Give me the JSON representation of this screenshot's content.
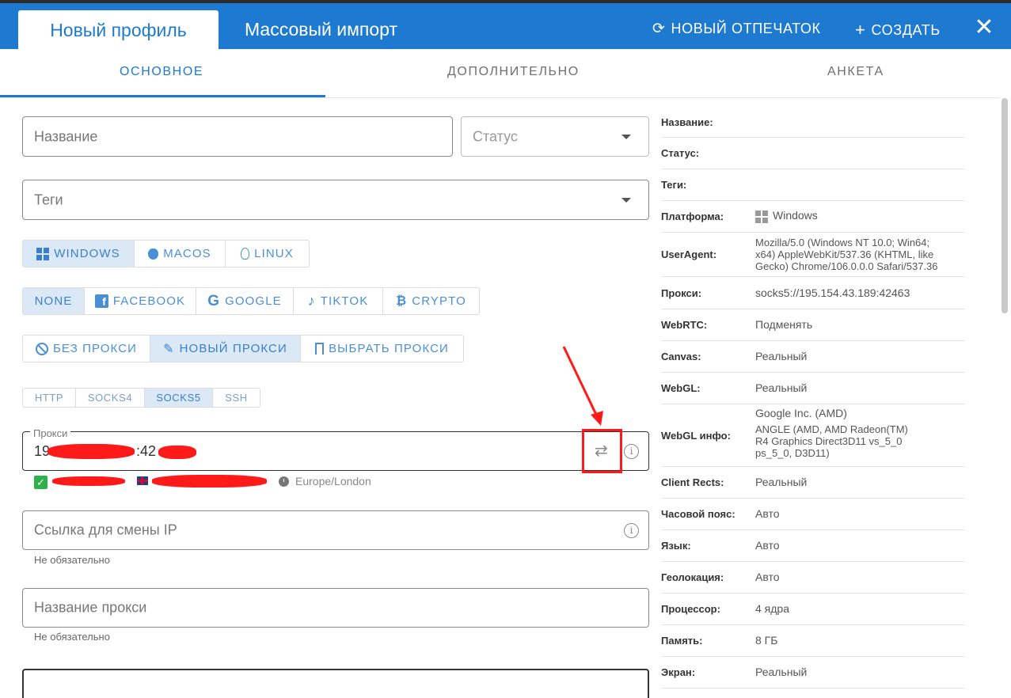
{
  "header": {
    "tab_new_profile": "Новый профиль",
    "tab_mass_import": "Массовый импорт",
    "new_fingerprint": "НОВЫЙ ОТПЕЧАТОК",
    "create": "СОЗДАТЬ",
    "close": "✕"
  },
  "subtabs": [
    "ОСНОВНОЕ",
    "ДОПОЛНИТЕЛЬНО",
    "АНКЕТА"
  ],
  "form": {
    "name_placeholder": "Название",
    "status_placeholder": "Статус",
    "tags_placeholder": "Теги",
    "os_options": [
      "WINDOWS",
      "MACOS",
      "LINUX"
    ],
    "preset_options": [
      "NONE",
      "FACEBOOK",
      "GOOGLE",
      "TIKTOK",
      "CRYPTO"
    ],
    "proxy_mode_options": [
      "БЕЗ ПРОКСИ",
      "НОВЫЙ ПРОКСИ",
      "ВЫБРАТЬ ПРОКСИ"
    ],
    "protocol_options": [
      "HTTP",
      "SOCKS4",
      "SOCKS5",
      "SSH"
    ],
    "proxy_label": "Прокси",
    "proxy_value_start": "19",
    "proxy_value_port_part": ":42",
    "timezone": "Europe/London",
    "ip_change_placeholder": "Ссылка для смены IP",
    "ip_change_helper": "Не обязательно",
    "proxy_name_placeholder": "Название прокси",
    "proxy_name_helper": "Не обязательно",
    "selected": {
      "os": "WINDOWS",
      "preset": "NONE",
      "proxy_mode": "НОВЫЙ ПРОКСИ",
      "protocol": "SOCKS5"
    }
  },
  "summary": {
    "name_label": "Название:",
    "status_label": "Статус:",
    "tags_label": "Теги:",
    "platform_label": "Платформа:",
    "platform_value": "Windows",
    "ua_label": "UserAgent:",
    "ua_line1": "Mozilla/5.0 (Windows NT 10.0; Win64;",
    "ua_line2": "x64) AppleWebKit/537.36 (KHTML, like",
    "ua_line3": "Gecko) Chrome/106.0.0.0 Safari/537.36",
    "proxy_label": "Прокси:",
    "proxy_value": "socks5://195.154.43.189:42463",
    "webrtc_label": "WebRTC:",
    "webrtc_value": "Подменять",
    "canvas_label": "Canvas:",
    "canvas_value": "Реальный",
    "webgl_label": "WebGL:",
    "webgl_value": "Реальный",
    "webgl_info_label": "WebGL инфо:",
    "webgl_info_line1": "Google Inc. (AMD)",
    "webgl_info_line2": "ANGLE (AMD, AMD Radeon(TM)",
    "webgl_info_line3": "R4 Graphics Direct3D11 vs_5_0",
    "webgl_info_line4": "ps_5_0, D3D11)",
    "client_rects_label": "Client Rects:",
    "client_rects_value": "Реальный",
    "timezone_label": "Часовой пояс:",
    "timezone_value": "Авто",
    "language_label": "Язык:",
    "language_value": "Авто",
    "geo_label": "Геолокация:",
    "geo_value": "Авто",
    "cpu_label": "Процессор:",
    "cpu_value": "4 ядра",
    "memory_label": "Память:",
    "memory_value": "8 ГБ",
    "screen_label": "Экран:",
    "screen_value": "Реальный"
  },
  "colors": {
    "brand": "#1e7ad1",
    "highlight": "#ff1a1a",
    "selected_bg": "#dbe9f7"
  }
}
